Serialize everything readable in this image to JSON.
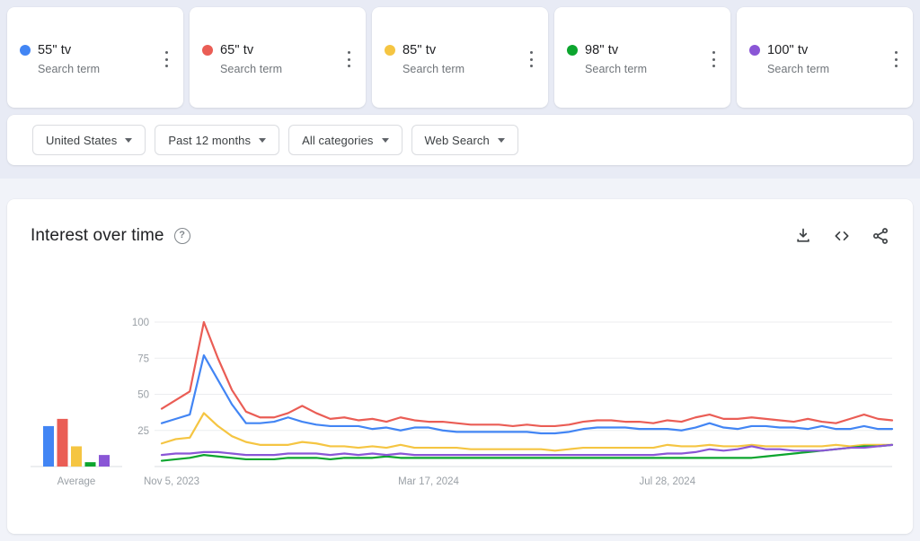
{
  "terms": [
    {
      "label": "55\" tv",
      "sub": "Search term",
      "color": "#4285F4",
      "menu_icon": "kebab-menu-icon"
    },
    {
      "label": "65\" tv",
      "sub": "Search term",
      "color": "#EA5D55",
      "menu_icon": "kebab-menu-icon"
    },
    {
      "label": "85\" tv",
      "sub": "Search term",
      "color": "#F5C542",
      "menu_icon": "kebab-menu-icon"
    },
    {
      "label": "98\" tv",
      "sub": "Search term",
      "color": "#0CA52E",
      "menu_icon": "kebab-menu-icon"
    },
    {
      "label": "100\" tv",
      "sub": "Search term",
      "color": "#8A56D6",
      "menu_icon": "kebab-menu-icon"
    }
  ],
  "filters": [
    {
      "label": "United States",
      "icon": "chevron-down-icon"
    },
    {
      "label": "Past 12 months",
      "icon": "chevron-down-icon"
    },
    {
      "label": "All categories",
      "icon": "chevron-down-icon"
    },
    {
      "label": "Web Search",
      "icon": "chevron-down-icon"
    }
  ],
  "chart_card": {
    "title": "Interest over time",
    "help_icon": "help-circle-icon",
    "help_glyph": "?",
    "actions": [
      {
        "name": "download-icon",
        "tooltip": "Download"
      },
      {
        "name": "embed-code-icon",
        "tooltip": "Embed"
      },
      {
        "name": "share-icon",
        "tooltip": "Share"
      }
    ]
  },
  "chart_data": {
    "type": "line",
    "title": "Interest over time",
    "xlabel": "",
    "ylabel": "",
    "ylim": [
      0,
      100
    ],
    "yticks": [
      25,
      50,
      75,
      100
    ],
    "grid": true,
    "legend": "external-cards",
    "xticks": [
      "Nov 5, 2023",
      "Mar 17, 2024",
      "Jul 28, 2024"
    ],
    "xtick_positions": [
      0,
      19,
      38
    ],
    "x_start": "Nov 5, 2023",
    "x_end": "Oct 27, 2024",
    "n_points": 53,
    "series": [
      {
        "name": "55\" tv",
        "color": "#4285F4",
        "values": [
          30,
          33,
          36,
          77,
          60,
          43,
          30,
          30,
          31,
          34,
          31,
          29,
          28,
          28,
          28,
          26,
          27,
          25,
          27,
          27,
          25,
          24,
          24,
          24,
          24,
          24,
          24,
          23,
          23,
          24,
          26,
          27,
          27,
          27,
          26,
          26,
          26,
          25,
          27,
          30,
          27,
          26,
          28,
          28,
          27,
          27,
          26,
          28,
          26,
          26,
          28,
          26,
          26
        ]
      },
      {
        "name": "65\" tv",
        "color": "#EA5D55",
        "values": [
          40,
          46,
          52,
          100,
          75,
          53,
          38,
          34,
          34,
          37,
          42,
          37,
          33,
          34,
          32,
          33,
          31,
          34,
          32,
          31,
          31,
          30,
          29,
          29,
          29,
          28,
          29,
          28,
          28,
          29,
          31,
          32,
          32,
          31,
          31,
          30,
          32,
          31,
          34,
          36,
          33,
          33,
          34,
          33,
          32,
          31,
          33,
          31,
          30,
          33,
          36,
          33,
          32
        ]
      },
      {
        "name": "85\" tv",
        "color": "#F5C542",
        "values": [
          16,
          19,
          20,
          37,
          28,
          21,
          17,
          15,
          15,
          15,
          17,
          16,
          14,
          14,
          13,
          14,
          13,
          15,
          13,
          13,
          13,
          13,
          12,
          12,
          12,
          12,
          12,
          12,
          11,
          12,
          13,
          13,
          13,
          13,
          13,
          13,
          15,
          14,
          14,
          15,
          14,
          14,
          15,
          14,
          14,
          14,
          14,
          14,
          15,
          14,
          15,
          15,
          15
        ]
      },
      {
        "name": "98\" tv",
        "color": "#0CA52E",
        "values": [
          4,
          5,
          6,
          8,
          7,
          6,
          5,
          5,
          5,
          6,
          6,
          6,
          5,
          6,
          6,
          6,
          7,
          6,
          6,
          6,
          6,
          6,
          6,
          6,
          6,
          6,
          6,
          6,
          6,
          6,
          6,
          6,
          6,
          6,
          6,
          6,
          6,
          6,
          6,
          6,
          6,
          6,
          6,
          7,
          8,
          9,
          10,
          11,
          12,
          13,
          14,
          14,
          15
        ]
      },
      {
        "name": "100\" tv",
        "color": "#8A56D6",
        "values": [
          8,
          9,
          9,
          10,
          10,
          9,
          8,
          8,
          8,
          9,
          9,
          9,
          8,
          9,
          8,
          9,
          8,
          9,
          8,
          8,
          8,
          8,
          8,
          8,
          8,
          8,
          8,
          8,
          8,
          8,
          8,
          8,
          8,
          8,
          8,
          8,
          9,
          9,
          10,
          12,
          11,
          12,
          14,
          12,
          12,
          11,
          11,
          11,
          12,
          13,
          13,
          14,
          15
        ]
      }
    ]
  },
  "average_chart": {
    "type": "bar",
    "label": "Average",
    "categories": [
      "55\" tv",
      "65\" tv",
      "85\" tv",
      "98\" tv",
      "100\" tv"
    ],
    "values": [
      28,
      33,
      14,
      3,
      8
    ],
    "colors": [
      "#4285F4",
      "#EA5D55",
      "#F5C542",
      "#0CA52E",
      "#8A56D6"
    ],
    "ylim": [
      0,
      100
    ]
  }
}
